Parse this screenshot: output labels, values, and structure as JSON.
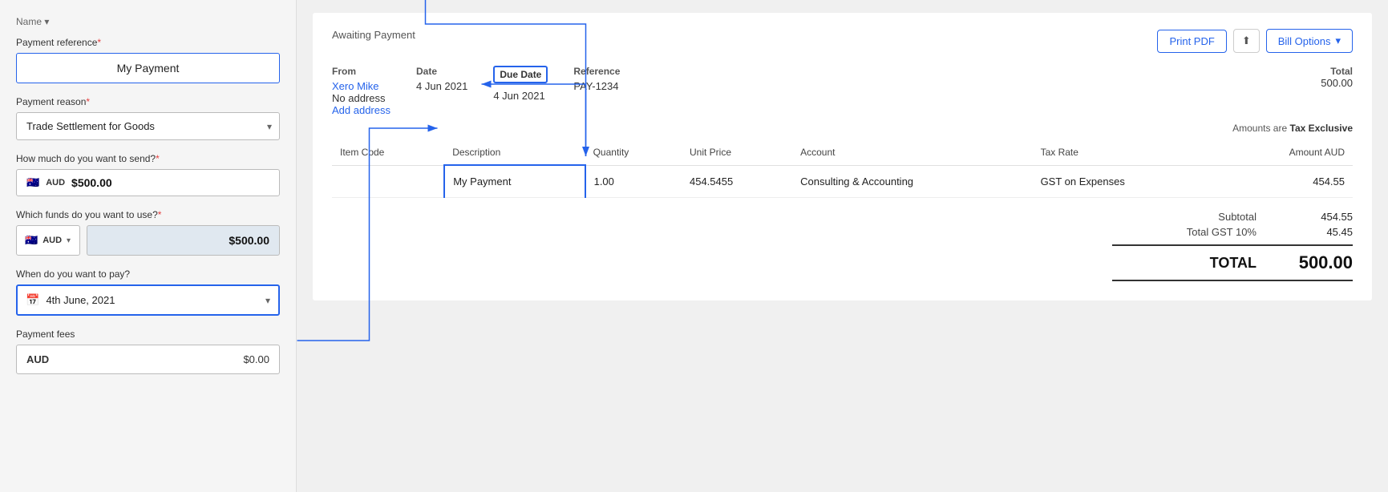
{
  "left_panel": {
    "breadcrumb": "Name ▾",
    "payment_reference_label": "Payment reference",
    "payment_reference_required": "*",
    "payment_reference_value": "My Payment",
    "payment_reason_label": "Payment reason",
    "payment_reason_required": "*",
    "payment_reason_value": "Trade Settlement for Goods",
    "amount_label": "How much do you want to send?",
    "amount_required": "*",
    "amount_currency": "AUD",
    "amount_value": "$500.00",
    "funds_label": "Which funds do you want to use?",
    "funds_required": "*",
    "funds_currency": "AUD",
    "funds_amount": "$500.00",
    "date_label": "When do you want to pay?",
    "date_value": "4th June, 2021",
    "fees_label": "Payment fees",
    "fees_currency": "AUD",
    "fees_amount": "$0.00"
  },
  "invoice": {
    "status": "Awaiting Payment",
    "print_btn": "Print PDF",
    "share_icon": "⬆",
    "bill_options_btn": "Bill Options",
    "from_label": "From",
    "from_name": "Xero Mike",
    "from_address_line1": "No address",
    "from_address_link": "Add address",
    "date_label": "Date",
    "date_value": "4 Jun 2021",
    "due_date_label": "Due Date",
    "due_date_value": "4 Jun 2021",
    "reference_label": "Reference",
    "reference_value": "PAY-1234",
    "total_label": "Total",
    "total_value": "500.00",
    "amounts_note": "Amounts are",
    "amounts_type": "Tax Exclusive",
    "table_headers": {
      "item_code": "Item Code",
      "description": "Description",
      "quantity": "Quantity",
      "unit_price": "Unit Price",
      "account": "Account",
      "tax_rate": "Tax Rate",
      "amount_aud": "Amount AUD"
    },
    "line_items": [
      {
        "item_code": "",
        "description": "My Payment",
        "quantity": "1.00",
        "unit_price": "454.5455",
        "account": "Consulting & Accounting",
        "tax_rate": "GST on Expenses",
        "amount_aud": "454.55"
      }
    ],
    "subtotal_label": "Subtotal",
    "subtotal_value": "454.55",
    "gst_label": "Total GST 10%",
    "gst_value": "45.45",
    "total_final_label": "TOTAL",
    "total_final_value": "500.00"
  }
}
